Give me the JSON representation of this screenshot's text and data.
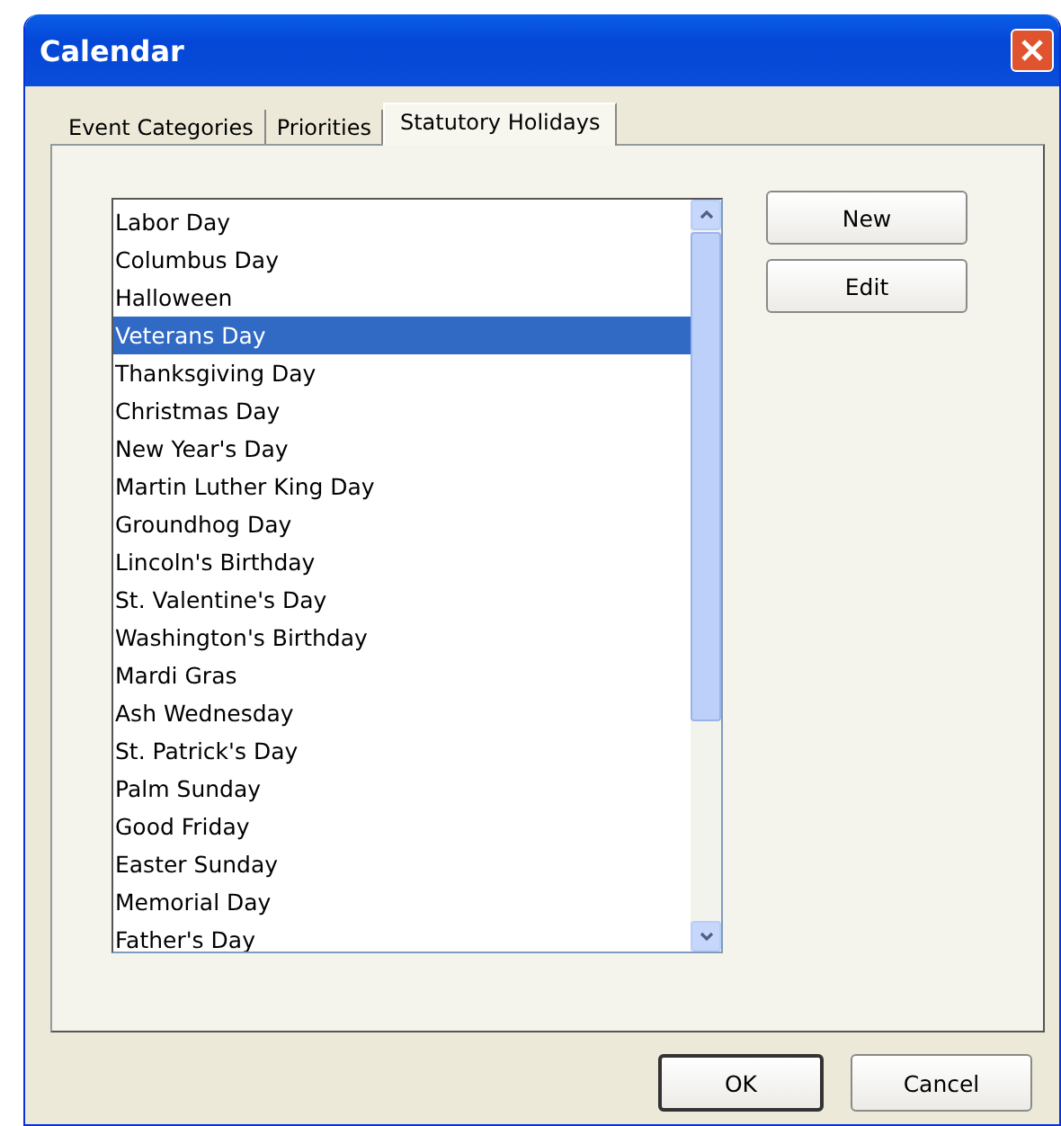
{
  "window": {
    "title": "Calendar"
  },
  "tabs": [
    {
      "label": "Event Categories",
      "selected": false
    },
    {
      "label": "Priorities",
      "selected": false
    },
    {
      "label": "Statutory Holidays",
      "selected": true
    }
  ],
  "holidays": [
    {
      "name": "Labor Day",
      "selected": false
    },
    {
      "name": "Columbus Day",
      "selected": false
    },
    {
      "name": "Halloween",
      "selected": false
    },
    {
      "name": "Veterans Day",
      "selected": true
    },
    {
      "name": "Thanksgiving Day",
      "selected": false
    },
    {
      "name": "Christmas Day",
      "selected": false
    },
    {
      "name": "New Year's Day",
      "selected": false
    },
    {
      "name": "Martin Luther King Day",
      "selected": false
    },
    {
      "name": "Groundhog Day",
      "selected": false
    },
    {
      "name": "Lincoln's Birthday",
      "selected": false
    },
    {
      "name": "St. Valentine's Day",
      "selected": false
    },
    {
      "name": "Washington's Birthday",
      "selected": false
    },
    {
      "name": "Mardi Gras",
      "selected": false
    },
    {
      "name": "Ash Wednesday",
      "selected": false
    },
    {
      "name": "St. Patrick's Day",
      "selected": false
    },
    {
      "name": "Palm Sunday",
      "selected": false
    },
    {
      "name": "Good Friday",
      "selected": false
    },
    {
      "name": "Easter Sunday",
      "selected": false
    },
    {
      "name": "Memorial Day",
      "selected": false
    },
    {
      "name": "Father's Day",
      "selected": false
    }
  ],
  "side_buttons": [
    "New",
    "Edit"
  ],
  "footer_buttons": [
    "OK",
    "Cancel"
  ]
}
